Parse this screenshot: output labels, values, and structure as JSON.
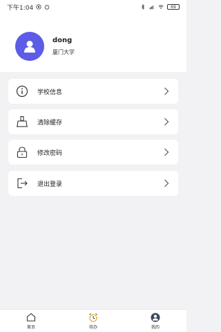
{
  "status_bar": {
    "time": "下午1:04",
    "battery": "69"
  },
  "profile": {
    "name": "dong",
    "school": "厦门大学"
  },
  "menu": [
    {
      "label": "学校信息",
      "icon": "info-icon"
    },
    {
      "label": "清除缓存",
      "icon": "broom-icon"
    },
    {
      "label": "修改密码",
      "icon": "lock-icon"
    },
    {
      "label": "退出登录",
      "icon": "logout-icon"
    }
  ],
  "tabs": [
    {
      "label": "首页",
      "icon": "home-icon"
    },
    {
      "label": "待办",
      "icon": "alarm-clock-icon"
    },
    {
      "label": "我的",
      "icon": "profile-icon"
    }
  ],
  "colors": {
    "accent": "#5c5ce6",
    "background": "#f2f2f4"
  }
}
